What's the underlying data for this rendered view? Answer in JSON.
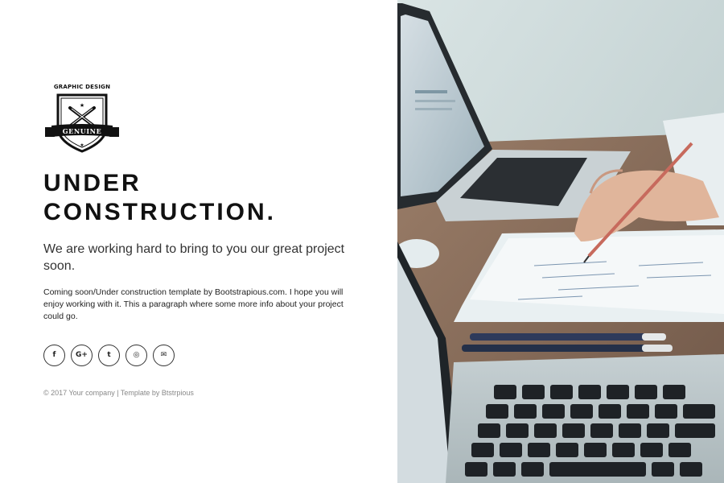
{
  "logo": {
    "top_text": "GRAPHIC DESIGN",
    "ribbon_text": "GENUINE"
  },
  "heading": {
    "line1": "UNDER",
    "line2": "CONSTRUCTION."
  },
  "lead": "We are working hard to bring to you our great project soon.",
  "description": "Coming soon/Under construction template by Bootstrapious.com. I hope you will enjoy working with it. This a paragraph where some more info about your project could go.",
  "social": [
    {
      "icon": "facebook-icon",
      "glyph": "f"
    },
    {
      "icon": "google-plus-icon",
      "glyph": "G+"
    },
    {
      "icon": "twitter-icon",
      "glyph": "t"
    },
    {
      "icon": "instagram-icon",
      "glyph": "◎"
    },
    {
      "icon": "envelope-icon",
      "glyph": "✉"
    }
  ],
  "footer": "© 2017 Your company | Template by Btstrpious",
  "colors": {
    "text": "#111111",
    "muted": "#888888",
    "background": "#ffffff"
  }
}
